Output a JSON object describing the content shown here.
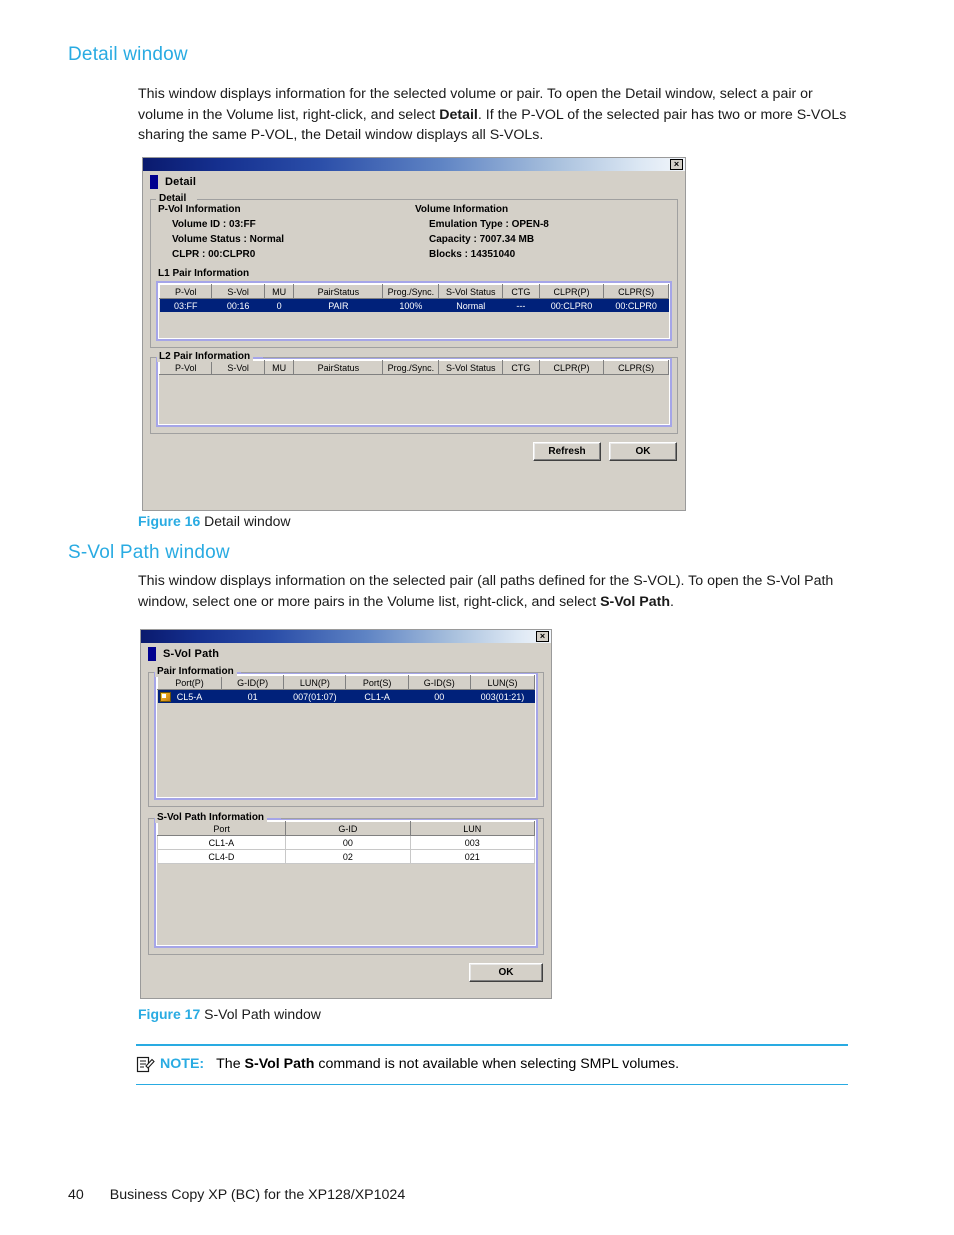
{
  "document": {
    "section1_heading": "Detail window",
    "section1_paragraph_part1": "This window displays information for the selected volume or pair. To open the Detail window, select a pair or volume in the Volume list, right-click, and select ",
    "section1_paragraph_bold": "Detail",
    "section1_paragraph_part2": ". If the P-VOL of the selected pair has two or more S-VOLs sharing the same P-VOL, the Detail window displays all S-VOLs.",
    "figure16_label": "Figure 16",
    "figure16_caption": "Detail window",
    "section2_heading": "S-Vol Path window",
    "section2_paragraph_part1": "This window displays information on the selected pair (all paths defined for the S-VOL). To open the S-Vol Path window, select one or more pairs in the Volume list, right-click, and select ",
    "section2_paragraph_bold": "S-Vol Path",
    "section2_paragraph_part2": ".",
    "figure17_label": "Figure 17",
    "figure17_caption": "S-Vol Path window",
    "note_label": "NOTE:",
    "note_text_part1": "The ",
    "note_text_bold": "S-Vol Path",
    "note_text_part2": " command is not available when selecting SMPL volumes.",
    "footer_page_number": "40",
    "footer_title": "Business Copy XP (BC) for the XP128/XP1024",
    "heading_color": "#29ABE2"
  },
  "detail_window": {
    "title": "Detail",
    "close_label": "×",
    "groupbox_legend": "Detail",
    "pvol_info_heading": "P-Vol Information",
    "pvol_info_lines": [
      "Volume ID : 03:FF",
      "Volume Status : Normal",
      "CLPR : 00:CLPR0"
    ],
    "volume_info_heading": "Volume Information",
    "volume_info_lines": [
      "Emulation Type : OPEN-8",
      "Capacity : 7007.34 MB",
      "Blocks : 14351040"
    ],
    "l1_heading": "L1 Pair Information",
    "l2_legend": "L2 Pair Information",
    "pair_columns": [
      "P-Vol",
      "S-Vol",
      "MU",
      "PairStatus",
      "Prog./Sync.",
      "S-Vol Status",
      "CTG",
      "CLPR(P)",
      "CLPR(S)"
    ],
    "l1_rows": [
      {
        "pvol": "03:FF",
        "svol": "00:16",
        "mu": "0",
        "pair_status": "PAIR",
        "prog_sync": "100%",
        "svol_status": "Normal",
        "ctg": "---",
        "clpr_p": "00:CLPR0",
        "clpr_s": "00:CLPR0",
        "selected": true
      }
    ],
    "l2_rows": [],
    "refresh_label": "Refresh",
    "ok_label": "OK"
  },
  "svol_path_window": {
    "title": "S-Vol Path",
    "close_label": "×",
    "pair_info_legend": "Pair Information",
    "pair_columns": [
      "Port(P)",
      "G-ID(P)",
      "LUN(P)",
      "Port(S)",
      "G-ID(S)",
      "LUN(S)"
    ],
    "pair_rows": [
      {
        "port_p": "CL5-A",
        "gid_p": "01",
        "lun_p": "007(01:07)",
        "port_s": "CL1-A",
        "gid_s": "00",
        "lun_s": "003(01:21)",
        "selected": true,
        "has_icon": true
      }
    ],
    "path_info_legend": "S-Vol Path Information",
    "path_columns": [
      "Port",
      "G-ID",
      "LUN"
    ],
    "path_rows": [
      {
        "port": "CL1-A",
        "gid": "00",
        "lun": "003"
      },
      {
        "port": "CL4-D",
        "gid": "02",
        "lun": "021"
      }
    ],
    "ok_label": "OK"
  }
}
